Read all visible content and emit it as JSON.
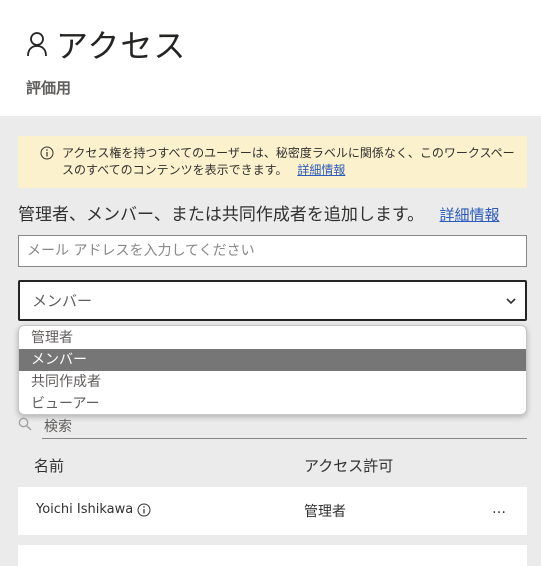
{
  "header": {
    "title": "アクセス",
    "subtitle": "評価用"
  },
  "banner": {
    "text": "アクセス権を持つすべてのユーザーは、秘密度ラベルに関係なく、このワークスペースのすべてのコンテンツを表示できます。",
    "link": "詳細情報"
  },
  "add": {
    "label": "管理者、メンバー、または共同作成者を追加します。",
    "link": "詳細情報",
    "email_placeholder": "メール アドレスを入力してください"
  },
  "role_select": {
    "value": "メンバー",
    "options": [
      "管理者",
      "メンバー",
      "共同作成者",
      "ビューアー"
    ],
    "selected_index": 1
  },
  "search": {
    "placeholder": "検索"
  },
  "table": {
    "headers": {
      "name": "名前",
      "access": "アクセス許可"
    },
    "rows": [
      {
        "name": "Yoichi Ishikawa",
        "access": "管理者",
        "more": "…"
      },
      {
        "name": "",
        "access": "",
        "more": ""
      }
    ]
  }
}
